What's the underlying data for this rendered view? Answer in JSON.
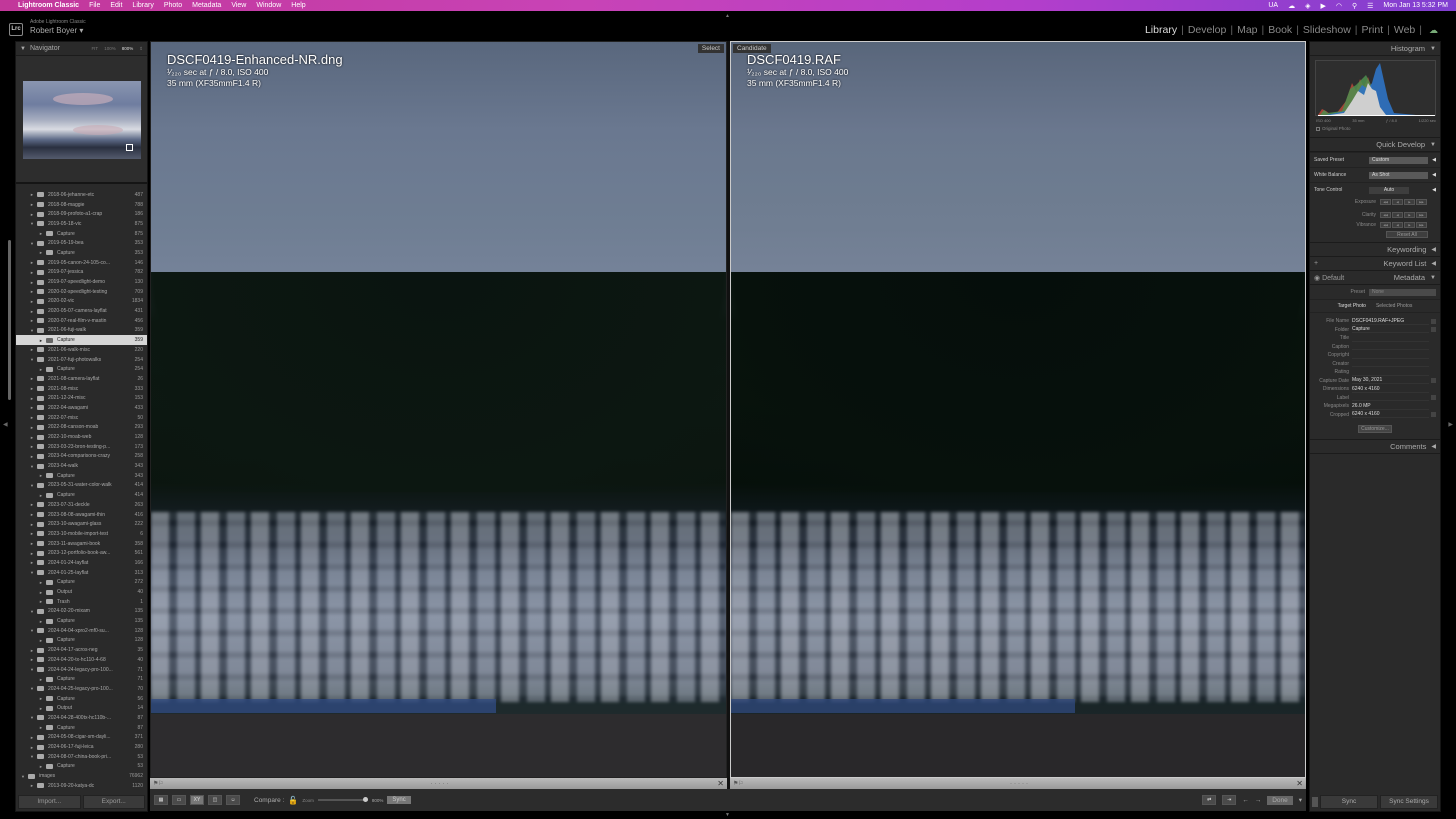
{
  "menubar": {
    "app": "Lightroom Classic",
    "items": [
      "File",
      "Edit",
      "Library",
      "Photo",
      "Metadata",
      "View",
      "Window",
      "Help"
    ],
    "status": {
      "input": "UA",
      "datetime": "Mon Jan 13  5:32 PM"
    }
  },
  "identity": {
    "app_name": "Adobe Lightroom Classic",
    "user": "Robert Boyer ▾",
    "logo": "Lrc"
  },
  "modules": [
    "Library",
    "Develop",
    "Map",
    "Book",
    "Slideshow",
    "Print",
    "Web"
  ],
  "active_module": "Library",
  "navigator": {
    "title": "Navigator",
    "zoom_options": [
      "FIT",
      "100%",
      "800%"
    ],
    "selected_zoom": "800%"
  },
  "folders": [
    {
      "name": "2018-06-jehanne-etc",
      "count": "487",
      "level": 1,
      "arrow": "►"
    },
    {
      "name": "2018-08-maggie",
      "count": "788",
      "level": 1,
      "arrow": "►"
    },
    {
      "name": "2018-09-profoto-a1-crap",
      "count": "186",
      "level": 1,
      "arrow": "►"
    },
    {
      "name": "2019-05-18-vic",
      "count": "875",
      "level": 1,
      "arrow": "▼"
    },
    {
      "name": "Capture",
      "count": "875",
      "level": 2,
      "arrow": "►"
    },
    {
      "name": "2019-05-19-bea",
      "count": "353",
      "level": 1,
      "arrow": "▼"
    },
    {
      "name": "Capture",
      "count": "353",
      "level": 2,
      "arrow": "►"
    },
    {
      "name": "2019-05-canon-24-105-co...",
      "count": "146",
      "level": 1,
      "arrow": "►"
    },
    {
      "name": "2019-07-jessica",
      "count": "782",
      "level": 1,
      "arrow": "►"
    },
    {
      "name": "2019-07-speedlight-demo",
      "count": "130",
      "level": 1,
      "arrow": "►"
    },
    {
      "name": "2020-02-speedlight-testing",
      "count": "709",
      "level": 1,
      "arrow": "►"
    },
    {
      "name": "2020-02-vic",
      "count": "1834",
      "level": 1,
      "arrow": "►"
    },
    {
      "name": "2020-05-07-camera-layflat",
      "count": "431",
      "level": 1,
      "arrow": "►"
    },
    {
      "name": "2020-07-real-film-v-mastin",
      "count": "456",
      "level": 1,
      "arrow": "►"
    },
    {
      "name": "2021-06-fuji-walk",
      "count": "359",
      "level": 1,
      "arrow": "▼"
    },
    {
      "name": "Capture",
      "count": "359",
      "level": 2,
      "arrow": "►",
      "selected": true
    },
    {
      "name": "2021-06-walk-misc",
      "count": "220",
      "level": 1,
      "arrow": "►"
    },
    {
      "name": "2021-07-fuji-photowalks",
      "count": "254",
      "level": 1,
      "arrow": "▼"
    },
    {
      "name": "Capture",
      "count": "254",
      "level": 2,
      "arrow": "►"
    },
    {
      "name": "2021-08-camera-layflat",
      "count": "26",
      "level": 1,
      "arrow": "►"
    },
    {
      "name": "2021-08-misc",
      "count": "333",
      "level": 1,
      "arrow": "►"
    },
    {
      "name": "2021-12-24-misc",
      "count": "153",
      "level": 1,
      "arrow": "►"
    },
    {
      "name": "2022-04-awagami",
      "count": "433",
      "level": 1,
      "arrow": "►"
    },
    {
      "name": "2022-07-misc",
      "count": "50",
      "level": 1,
      "arrow": "►"
    },
    {
      "name": "2022-08-canson-moab",
      "count": "293",
      "level": 1,
      "arrow": "►"
    },
    {
      "name": "2022-10-moab-web",
      "count": "128",
      "level": 1,
      "arrow": "►"
    },
    {
      "name": "2023-03-23-bron-testing-p...",
      "count": "173",
      "level": 1,
      "arrow": "►"
    },
    {
      "name": "2023-04-comparisons-crazy",
      "count": "258",
      "level": 1,
      "arrow": "►"
    },
    {
      "name": "2023-04-walk",
      "count": "343",
      "level": 1,
      "arrow": "▼"
    },
    {
      "name": "Capture",
      "count": "343",
      "level": 2,
      "arrow": "►"
    },
    {
      "name": "2023-05-31-water-color-walk",
      "count": "414",
      "level": 1,
      "arrow": "▼"
    },
    {
      "name": "Capture",
      "count": "414",
      "level": 2,
      "arrow": "►"
    },
    {
      "name": "2023-07-31-deckle",
      "count": "263",
      "level": 1,
      "arrow": "►"
    },
    {
      "name": "2023-08-08-awagami-thin",
      "count": "416",
      "level": 1,
      "arrow": "►"
    },
    {
      "name": "2023-10-awagami-glass",
      "count": "222",
      "level": 1,
      "arrow": "►"
    },
    {
      "name": "2023-10-mobile-import-test",
      "count": "6",
      "level": 1,
      "arrow": "►"
    },
    {
      "name": "2023-11-awagami-book",
      "count": "358",
      "level": 1,
      "arrow": "►"
    },
    {
      "name": "2023-12-portfolio-book-aw...",
      "count": "561",
      "level": 1,
      "arrow": "►"
    },
    {
      "name": "2024-01-24-layflat",
      "count": "166",
      "level": 1,
      "arrow": "►"
    },
    {
      "name": "2024-01-25-layflat",
      "count": "313",
      "level": 1,
      "arrow": "▼"
    },
    {
      "name": "Capture",
      "count": "272",
      "level": 2,
      "arrow": "►"
    },
    {
      "name": "Output",
      "count": "40",
      "level": 2,
      "arrow": "►"
    },
    {
      "name": "Trash",
      "count": "1",
      "level": 2,
      "arrow": "►"
    },
    {
      "name": "2024-02-20-mixam",
      "count": "135",
      "level": 1,
      "arrow": "▼"
    },
    {
      "name": "Capture",
      "count": "135",
      "level": 2,
      "arrow": "►"
    },
    {
      "name": "2024-04-04-xpro2-mf0-su...",
      "count": "128",
      "level": 1,
      "arrow": "▼"
    },
    {
      "name": "Capture",
      "count": "128",
      "level": 2,
      "arrow": "►"
    },
    {
      "name": "2024-04-17-acros-neg",
      "count": "35",
      "level": 1,
      "arrow": "►"
    },
    {
      "name": "2024-04-20-tx-hc110-4-68",
      "count": "40",
      "level": 1,
      "arrow": "►"
    },
    {
      "name": "2024-04-24-legacy-pro-100...",
      "count": "71",
      "level": 1,
      "arrow": "▼"
    },
    {
      "name": "Capture",
      "count": "71",
      "level": 2,
      "arrow": "►"
    },
    {
      "name": "2024-04-25-legacy-pro-100...",
      "count": "70",
      "level": 1,
      "arrow": "▼"
    },
    {
      "name": "Capture",
      "count": "56",
      "level": 2,
      "arrow": "►"
    },
    {
      "name": "Output",
      "count": "14",
      "level": 2,
      "arrow": "►"
    },
    {
      "name": "2024-04-28-400tx-hc110b-...",
      "count": "87",
      "level": 1,
      "arrow": "▼"
    },
    {
      "name": "Capture",
      "count": "87",
      "level": 2,
      "arrow": "►"
    },
    {
      "name": "2024-05-08-cigar-sm-dayli...",
      "count": "371",
      "level": 1,
      "arrow": "►"
    },
    {
      "name": "2024-06-17-fuji-leica",
      "count": "280",
      "level": 1,
      "arrow": "►"
    },
    {
      "name": "2024-08-07-china-book-pri...",
      "count": "53",
      "level": 1,
      "arrow": "▼"
    },
    {
      "name": "Capture",
      "count": "53",
      "level": 2,
      "arrow": "►"
    },
    {
      "name": "images",
      "count": "76962",
      "level": 0,
      "arrow": "▼"
    },
    {
      "name": "2013-09-20-katya-dc",
      "count": "1120",
      "level": 1,
      "arrow": "►"
    }
  ],
  "left_buttons": {
    "import": "Import...",
    "export": "Export..."
  },
  "compare": {
    "select": {
      "label": "Select",
      "filename": "DSCF0419-Enhanced-NR.dng",
      "exposure": "¹⁄₂₂₀ sec at ƒ / 8.0, ISO 400",
      "lens": "35 mm (XF35mmF1.4 R)"
    },
    "candidate": {
      "label": "Candidate",
      "filename": "DSCF0419.RAF",
      "exposure": "¹⁄₂₂₀ sec at ƒ / 8.0, ISO 400",
      "lens": "35 mm (XF35mmF1.4 R)"
    }
  },
  "toolbar": {
    "compare_label": "Compare :",
    "zoom_label": "Zoom",
    "zoom_value": "800%",
    "zoom_fraction": 1.0,
    "sync_label": "Sync",
    "done_label": "Done",
    "xy_label": "XY"
  },
  "histogram": {
    "title": "Histogram",
    "iso": "ISO 400",
    "focal": "35 mm",
    "aperture": "ƒ / 8.0",
    "shutter": "1/220 sec",
    "original_photo": "Original Photo"
  },
  "quick_develop": {
    "title": "Quick Develop",
    "saved_preset_label": "Saved Preset",
    "saved_preset_value": "Custom",
    "white_balance_label": "White Balance",
    "white_balance_value": "As Shot",
    "tone_control_label": "Tone Control",
    "auto_label": "Auto",
    "exposure_label": "Exposure",
    "clarity_label": "Clarity",
    "vibrance_label": "Vibrance",
    "reset_label": "Reset All"
  },
  "panels": {
    "keywording": "Keywording",
    "keyword_list": "Keyword List",
    "metadata": "Metadata",
    "comments": "Comments",
    "metadata_set": "Default"
  },
  "metadata": {
    "preset_label": "Preset",
    "preset_value": "None",
    "tabs": [
      "Target Photo",
      "Selected Photos"
    ],
    "rows": [
      {
        "key": "File Name",
        "value": "DSCF0419.RAF+JPEG"
      },
      {
        "key": "Folder",
        "value": "Capture"
      },
      {
        "key": "Title",
        "value": ""
      },
      {
        "key": "Caption",
        "value": ""
      },
      {
        "key": "Copyright",
        "value": ""
      },
      {
        "key": "Creator",
        "value": ""
      },
      {
        "key": "Rating",
        "value": ""
      },
      {
        "key": "Capture Date",
        "value": "May 30, 2021"
      },
      {
        "key": "Dimensions",
        "value": "6240 x 4160"
      },
      {
        "key": "Label",
        "value": ""
      },
      {
        "key": "Megapixels",
        "value": "26.0 MP"
      },
      {
        "key": "Cropped",
        "value": "6240 x 4160"
      }
    ],
    "customize": "Customize..."
  },
  "right_buttons": {
    "sync": "Sync",
    "sync_settings": "Sync Settings"
  }
}
